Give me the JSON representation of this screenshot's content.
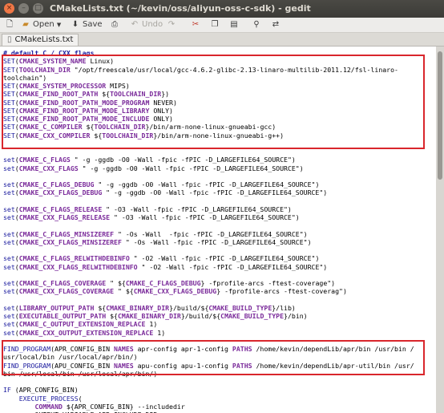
{
  "window": {
    "title": "CMakeLists.txt (~/kevin/oss/aliyun-oss-c-sdk) - gedit",
    "controls": [
      "close",
      "minimize",
      "maximize"
    ]
  },
  "toolbar": {
    "open_label": "Open",
    "save_label": "Save",
    "undo_label": "Undo",
    "icons": [
      "new-document-icon",
      "open-folder-icon",
      "save-icon",
      "print-icon",
      "undo-icon",
      "redo-icon",
      "cut-icon",
      "copy-icon",
      "paste-icon",
      "search-icon",
      "replace-icon"
    ]
  },
  "tab": {
    "label": "CMakeLists.txt"
  },
  "editor": {
    "lines": [
      [
        {
          "t": "# default C / CXX flags",
          "c": "cm"
        }
      ],
      [
        {
          "t": "SET",
          "c": "kw"
        },
        {
          "t": "(",
          "c": "pl"
        },
        {
          "t": "CMAKE_SYSTEM_NAME",
          "c": "var"
        },
        {
          "t": " Linux)",
          "c": "pl"
        }
      ],
      [
        {
          "t": "SET",
          "c": "kw"
        },
        {
          "t": "(",
          "c": "pl"
        },
        {
          "t": "TOOLCHAIN_DIR",
          "c": "var"
        },
        {
          "t": " \"/opt/freescale/usr/local/gcc-4.6.2-glibc-2.13-linaro-multilib-2011.12/fsl-linaro-",
          "c": "pl"
        }
      ],
      [
        {
          "t": "toolchain\")",
          "c": "pl"
        }
      ],
      [
        {
          "t": "SET",
          "c": "kw"
        },
        {
          "t": "(",
          "c": "pl"
        },
        {
          "t": "CMAKE_SYSTEM_PROCESSOR",
          "c": "var"
        },
        {
          "t": " MIPS)",
          "c": "pl"
        }
      ],
      [
        {
          "t": "SET",
          "c": "kw"
        },
        {
          "t": "(",
          "c": "pl"
        },
        {
          "t": "CMAKE_FIND_ROOT_PATH",
          "c": "var"
        },
        {
          "t": " ${",
          "c": "pl"
        },
        {
          "t": "TOOLCHAIN_DIR",
          "c": "var"
        },
        {
          "t": "})",
          "c": "pl"
        }
      ],
      [
        {
          "t": "SET",
          "c": "kw"
        },
        {
          "t": "(",
          "c": "pl"
        },
        {
          "t": "CMAKE_FIND_ROOT_PATH_MODE_PROGRAM",
          "c": "var"
        },
        {
          "t": " NEVER)",
          "c": "pl"
        }
      ],
      [
        {
          "t": "SET",
          "c": "kw"
        },
        {
          "t": "(",
          "c": "pl"
        },
        {
          "t": "CMAKE_FIND_ROOT_PATH_MODE_LIBRARY",
          "c": "var"
        },
        {
          "t": " ONLY)",
          "c": "pl"
        }
      ],
      [
        {
          "t": "SET",
          "c": "kw"
        },
        {
          "t": "(",
          "c": "pl"
        },
        {
          "t": "CMAKE_FIND_ROOT_PATH_MODE_INCLUDE",
          "c": "var"
        },
        {
          "t": " ONLY)",
          "c": "pl"
        }
      ],
      [
        {
          "t": "SET",
          "c": "kw"
        },
        {
          "t": "(",
          "c": "pl"
        },
        {
          "t": "CMAKE_C_COMPILER",
          "c": "var"
        },
        {
          "t": " ${",
          "c": "pl"
        },
        {
          "t": "TOOLCHAIN_DIR",
          "c": "var"
        },
        {
          "t": "}/bin/arm-none-linux-gnueabi-gcc)",
          "c": "pl"
        }
      ],
      [
        {
          "t": "SET",
          "c": "kw"
        },
        {
          "t": "(",
          "c": "pl"
        },
        {
          "t": "CMAKE_CXX_COMPILER",
          "c": "var"
        },
        {
          "t": " ${",
          "c": "pl"
        },
        {
          "t": "TOOLCHAIN_DIR",
          "c": "var"
        },
        {
          "t": "}/bin/arm-none-linux-gnueabi-g++)",
          "c": "pl"
        }
      ],
      [],
      [],
      [
        {
          "t": "set",
          "c": "kw"
        },
        {
          "t": "(",
          "c": "pl"
        },
        {
          "t": "CMAKE_C_FLAGS",
          "c": "var"
        },
        {
          "t": " \" -g -ggdb -O0 -Wall -fpic -fPIC -D_LARGEFILE64_SOURCE\")",
          "c": "pl"
        }
      ],
      [
        {
          "t": "set",
          "c": "kw"
        },
        {
          "t": "(",
          "c": "pl"
        },
        {
          "t": "CMAKE_CXX_FLAGS",
          "c": "var"
        },
        {
          "t": " \" -g -ggdb -O0 -Wall -fpic -fPIC -D_LARGEFILE64_SOURCE\")",
          "c": "pl"
        }
      ],
      [],
      [
        {
          "t": "set",
          "c": "kw"
        },
        {
          "t": "(",
          "c": "pl"
        },
        {
          "t": "CMAKE_C_FLAGS_DEBUG",
          "c": "var"
        },
        {
          "t": " \" -g -ggdb -O0 -Wall -fpic -fPIC -D_LARGEFILE64_SOURCE\")",
          "c": "pl"
        }
      ],
      [
        {
          "t": "set",
          "c": "kw"
        },
        {
          "t": "(",
          "c": "pl"
        },
        {
          "t": "CMAKE_CXX_FLAGS_DEBUG",
          "c": "var"
        },
        {
          "t": " \" -g -ggdb -O0 -Wall -fpic -fPIC -D_LARGEFILE64_SOURCE\")",
          "c": "pl"
        }
      ],
      [],
      [
        {
          "t": "set",
          "c": "kw"
        },
        {
          "t": "(",
          "c": "pl"
        },
        {
          "t": "CMAKE_C_FLAGS_RELEASE",
          "c": "var"
        },
        {
          "t": " \" -O3 -Wall -fpic -fPIC -D_LARGEFILE64_SOURCE\")",
          "c": "pl"
        }
      ],
      [
        {
          "t": "set",
          "c": "kw"
        },
        {
          "t": "(",
          "c": "pl"
        },
        {
          "t": "CMAKE_CXX_FLAGS_RELEASE",
          "c": "var"
        },
        {
          "t": " \" -O3 -Wall -fpic -fPIC -D_LARGEFILE64_SOURCE\")",
          "c": "pl"
        }
      ],
      [],
      [
        {
          "t": "set",
          "c": "kw"
        },
        {
          "t": "(",
          "c": "pl"
        },
        {
          "t": "CMAKE_C_FLAGS_MINSIZEREF",
          "c": "var"
        },
        {
          "t": " \" -Os -Wall  -fpic -fPIC -D_LARGEFILE64_SOURCE\")",
          "c": "pl"
        }
      ],
      [
        {
          "t": "set",
          "c": "kw"
        },
        {
          "t": "(",
          "c": "pl"
        },
        {
          "t": "CMAKE_CXX_FLAGS_MINSIZEREF",
          "c": "var"
        },
        {
          "t": " \" -Os -Wall -fpic -fPIC -D_LARGEFILE64_SOURCE\")",
          "c": "pl"
        }
      ],
      [],
      [
        {
          "t": "set",
          "c": "kw"
        },
        {
          "t": "(",
          "c": "pl"
        },
        {
          "t": "CMAKE_C_FLAGS_RELWITHDEBINFO",
          "c": "var"
        },
        {
          "t": " \" -O2 -Wall -fpic -fPIC -D_LARGEFILE64_SOURCE\")",
          "c": "pl"
        }
      ],
      [
        {
          "t": "set",
          "c": "kw"
        },
        {
          "t": "(",
          "c": "pl"
        },
        {
          "t": "CMAKE_CXX_FLAGS_RELWITHDEBINFO",
          "c": "var"
        },
        {
          "t": " \" -O2 -Wall -fpic -fPIC -D_LARGEFILE64_SOURCE\")",
          "c": "pl"
        }
      ],
      [],
      [
        {
          "t": "set",
          "c": "kw"
        },
        {
          "t": "(",
          "c": "pl"
        },
        {
          "t": "CMAKE_C_FLAGS_COVERAGE",
          "c": "var"
        },
        {
          "t": " \" ${",
          "c": "pl"
        },
        {
          "t": "CMAKE_C_FLAGS_DEBUG",
          "c": "var"
        },
        {
          "t": "} -fprofile-arcs -ftest-coverage\")",
          "c": "pl"
        }
      ],
      [
        {
          "t": "set",
          "c": "kw"
        },
        {
          "t": "(",
          "c": "pl"
        },
        {
          "t": "CMAKE_CXX_FLAGS_COVERAGE",
          "c": "var"
        },
        {
          "t": " \" ${",
          "c": "pl"
        },
        {
          "t": "CMAKE_CXX_FLAGS_DEBUG",
          "c": "var"
        },
        {
          "t": "} -fprofile-arcs -ftest-coverag\")",
          "c": "pl"
        }
      ],
      [],
      [
        {
          "t": "set",
          "c": "kw"
        },
        {
          "t": "(",
          "c": "pl"
        },
        {
          "t": "LIBRARY_OUTPUT_PATH",
          "c": "var"
        },
        {
          "t": " ${",
          "c": "pl"
        },
        {
          "t": "CMAKE_BINARY_DIR",
          "c": "var"
        },
        {
          "t": "}/build/${",
          "c": "pl"
        },
        {
          "t": "CMAKE_BUILD_TYPE",
          "c": "var"
        },
        {
          "t": "}/lib)",
          "c": "pl"
        }
      ],
      [
        {
          "t": "set",
          "c": "kw"
        },
        {
          "t": "(",
          "c": "pl"
        },
        {
          "t": "EXECUTABLE_OUTPUT_PATH",
          "c": "var"
        },
        {
          "t": " ${",
          "c": "pl"
        },
        {
          "t": "CMAKE_BINARY_DIR",
          "c": "var"
        },
        {
          "t": "}/build/${",
          "c": "pl"
        },
        {
          "t": "CMAKE_BUILD_TYPE",
          "c": "var"
        },
        {
          "t": "}/bin)",
          "c": "pl"
        }
      ],
      [
        {
          "t": "set",
          "c": "kw"
        },
        {
          "t": "(",
          "c": "pl"
        },
        {
          "t": "CMAKE_C_OUTPUT_EXTENSION_REPLACE",
          "c": "var"
        },
        {
          "t": " 1)",
          "c": "pl"
        }
      ],
      [
        {
          "t": "set",
          "c": "kw"
        },
        {
          "t": "(",
          "c": "pl"
        },
        {
          "t": "CMAKE_CXX_OUTPUT_EXTENSION_REPLACE",
          "c": "var"
        },
        {
          "t": " 1)",
          "c": "pl"
        }
      ],
      [],
      [
        {
          "t": "FIND_PROGRAM",
          "c": "kw"
        },
        {
          "t": "(APR_CONFIG_BIN ",
          "c": "pl"
        },
        {
          "t": "NAMES",
          "c": "var"
        },
        {
          "t": " apr-config apr-1-config ",
          "c": "pl"
        },
        {
          "t": "PATHS",
          "c": "var"
        },
        {
          "t": " /home/kevin/dependLib/apr/bin /usr/bin /",
          "c": "pl"
        }
      ],
      [
        {
          "t": "usr/local/bin /usr/local/apr/bin/)",
          "c": "pl"
        }
      ],
      [
        {
          "t": "FIND_PROGRAM",
          "c": "kw"
        },
        {
          "t": "(APU_CONFIG_BIN ",
          "c": "pl"
        },
        {
          "t": "NAMES",
          "c": "var"
        },
        {
          "t": " apu-config apu-1-config ",
          "c": "pl"
        },
        {
          "t": "PATHS",
          "c": "var"
        },
        {
          "t": " /home/kevin/dependLib/apr-util/bin /usr/",
          "c": "pl"
        }
      ],
      [
        {
          "t": "bin /usr/local/bin /usr/local/apr/bin/)",
          "c": "pl"
        }
      ],
      [],
      [
        {
          "t": "IF",
          "c": "kw"
        },
        {
          "t": " (APR_CONFIG_BIN)",
          "c": "pl"
        }
      ],
      [
        {
          "t": "    ",
          "c": "pl"
        },
        {
          "t": "EXECUTE_PROCESS",
          "c": "kw"
        },
        {
          "t": "(",
          "c": "pl"
        }
      ],
      [
        {
          "t": "        ",
          "c": "pl"
        },
        {
          "t": "COMMAND",
          "c": "var"
        },
        {
          "t": " ${APR_CONFIG_BIN} --includedir",
          "c": "pl"
        }
      ],
      [
        {
          "t": "        OUTPUT_VARIABLE APR_INCLUDE_DIR",
          "c": "pl"
        }
      ]
    ]
  }
}
